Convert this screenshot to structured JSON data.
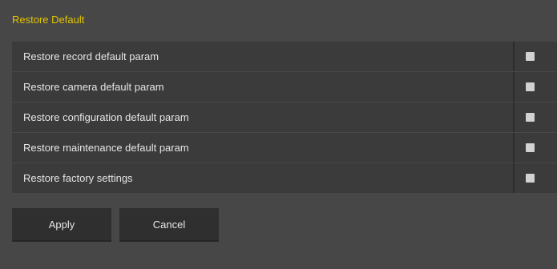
{
  "panel": {
    "title": "Restore Default"
  },
  "options": [
    {
      "label": "Restore record default param",
      "checked": false
    },
    {
      "label": "Restore camera default param",
      "checked": false
    },
    {
      "label": "Restore configuration default param",
      "checked": false
    },
    {
      "label": "Restore maintenance default param",
      "checked": false
    },
    {
      "label": "Restore factory settings",
      "checked": false
    }
  ],
  "buttons": {
    "apply_label": "Apply",
    "cancel_label": "Cancel"
  },
  "colors": {
    "title": "#e2c400",
    "background": "#474747",
    "row": "#3b3b3b",
    "button": "#2f2f2f",
    "checkbox": "#d2d2d2"
  }
}
